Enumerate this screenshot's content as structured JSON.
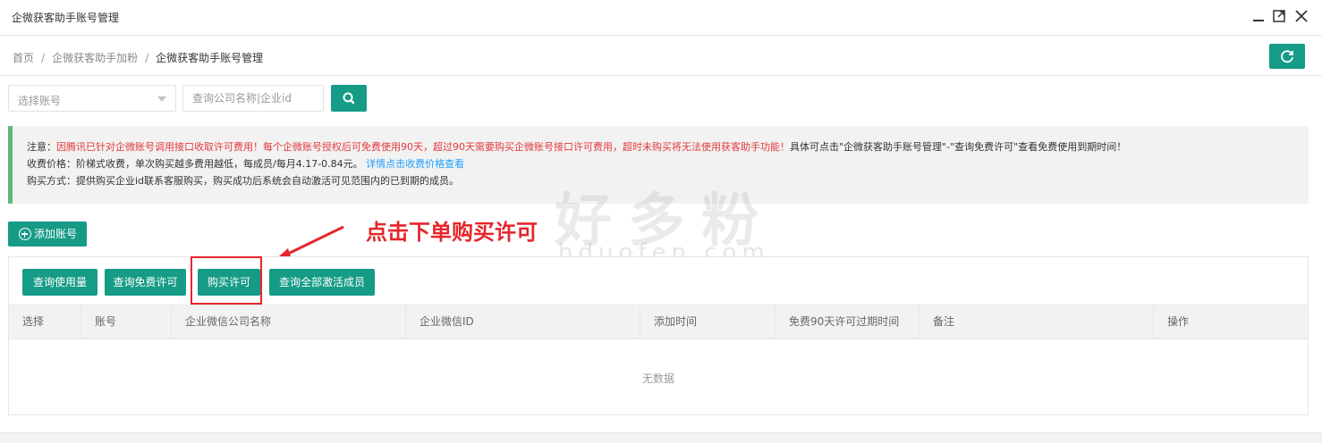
{
  "window": {
    "title": "企微获客助手账号管理",
    "controls": [
      "minimize-icon",
      "maximize-icon",
      "close-icon"
    ]
  },
  "breadcrumb": {
    "items": [
      "首页",
      "企微获客助手加粉",
      "企微获客助手账号管理"
    ],
    "separator": "/"
  },
  "filters": {
    "account_select_placeholder": "选择账号",
    "search_placeholder": "查询公司名称|企业id"
  },
  "notice": {
    "line1_prefix": "注意：",
    "line1_red": "因腾讯已针对企微账号调用接口收取许可费用！每个企微账号授权后可免费使用90天，超过90天需要购买企微账号接口许可费用，超时未购买将无法使用获客助手功能！",
    "line1_suffix": "具体可点击\"企微获客助手账号管理\"-\"查询免费许可\"查看免费使用到期时间！",
    "line2": "收费价格：阶梯式收费，单次购买越多费用越低，每成员/每月4.17-0.84元。",
    "line2_link": "详情点击收费价格查看",
    "line3": "购买方式：提供购买企业id联系客服购买，购买成功后系统会自动激活可见范围内的已到期的成员。"
  },
  "actions": {
    "add_account": "添加账号"
  },
  "annotation": {
    "text": "点击下单购买许可"
  },
  "watermark": {
    "cn": "好多粉",
    "en": "hduofen.com"
  },
  "toolbar": {
    "query_usage": "查询使用量",
    "query_free_license": "查询免费许可",
    "buy_license": "购买许可",
    "query_all_active": "查询全部激活成员"
  },
  "table": {
    "columns": [
      "选择",
      "账号",
      "企业微信公司名称",
      "企业微信ID",
      "添加时间",
      "免费90天许可过期时间",
      "备注",
      "操作"
    ],
    "rows": [],
    "empty_text": "无数据"
  },
  "colors": {
    "primary": "#169b86",
    "notice_border": "#5fb878",
    "warning_red": "#e4393c",
    "annotation_red": "#e5262c",
    "link": "#1e9fff"
  }
}
